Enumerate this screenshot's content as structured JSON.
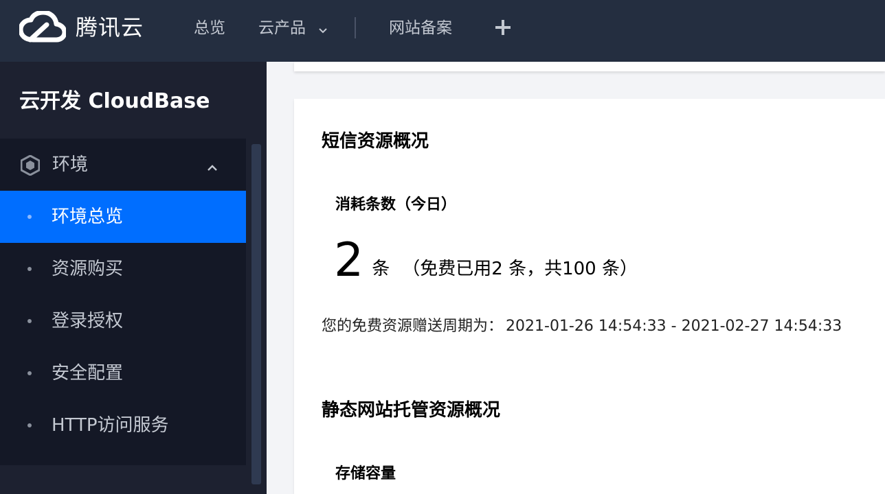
{
  "header": {
    "brand": "腾讯云",
    "nav": {
      "overview": "总览",
      "products": "云产品",
      "beian": "网站备案"
    }
  },
  "sidebar": {
    "title": "云开发 CloudBase",
    "group_label": "环境",
    "items": [
      {
        "label": "环境总览",
        "active": true
      },
      {
        "label": "资源购买",
        "active": false
      },
      {
        "label": "登录授权",
        "active": false
      },
      {
        "label": "安全配置",
        "active": false
      },
      {
        "label": "HTTP访问服务",
        "active": false
      }
    ]
  },
  "main": {
    "sms": {
      "title": "短信资源概况",
      "metric_label": "消耗条数（今日）",
      "value": "2",
      "unit": "条",
      "note": "（免费已用2 条，共100 条）",
      "period_label": "您的免费资源赠送周期为：",
      "period_range": "2021-01-26 14:54:33 - 2021-02-27 14:54:33"
    },
    "hosting": {
      "title": "静态网站托管资源概况",
      "metric_label": "存储容量"
    }
  },
  "colors": {
    "topbar": "#242e40",
    "sidebar": "#1d2130",
    "menu_bg": "#141826",
    "active": "#006eff",
    "page_bg": "#f3f4f7"
  },
  "icons": {
    "logo": "tencent-cloud-logo",
    "products_dropdown": "chevron-down-icon",
    "add": "plus-icon",
    "group": "hexagon-icon",
    "group_toggle": "chevron-up-icon"
  }
}
